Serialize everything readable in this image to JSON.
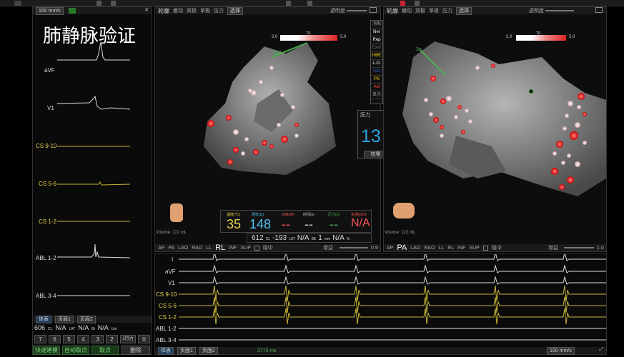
{
  "left_panel": {
    "speed": "150 mm/s",
    "title": "肺静脉验证",
    "channels": [
      {
        "label": "aVF",
        "color": "#dddddd"
      },
      {
        "label": "V1",
        "color": "#dddddd"
      },
      {
        "label": "CS 9-10",
        "color": "#e8d44d"
      },
      {
        "label": "CS 5-6",
        "color": "#e8d44d"
      },
      {
        "label": "CS 1-2",
        "color": "#e8d44d"
      },
      {
        "label": "ABL 1-2",
        "color": "#dddddd"
      },
      {
        "label": "ABL 3-4",
        "color": "#dddddd"
      }
    ],
    "tabs": [
      "体表",
      "页面1",
      "页面2"
    ],
    "readout": {
      "cl_val": "606",
      "cl_unit": "CL",
      "lat_val": "N/A",
      "lat_unit": "LAT",
      "bi_val": "N/A",
      "bi_unit": "Bi",
      "uni_val": "N/A",
      "uni_unit": "Uni"
    },
    "keys": [
      "7",
      "6",
      "5",
      "4",
      "3",
      "2",
      "1行力",
      "0"
    ],
    "buttons": [
      "快速建模",
      "自动取点",
      "取点",
      "删除"
    ]
  },
  "map_left": {
    "title": "轮廓",
    "menu": [
      "撤动",
      "双极",
      "单极",
      "压力"
    ],
    "dropdown": "选择",
    "opacity_label": "透明度",
    "scale_min": "2.0",
    "scale_mid": "TR",
    "scale_max": "5.0",
    "view": "RL",
    "views": [
      "AP",
      "PA",
      "LAO",
      "RAO",
      "LL",
      "RL",
      "INF",
      "SUP"
    ],
    "check_label": "隐中",
    "slider_label": "增益",
    "slider_value": "0.9",
    "volume": "Volume: 122 mL",
    "annotation": "13m"
  },
  "map_right": {
    "title": "轮廓",
    "menu": [
      "撤动",
      "双极",
      "单极",
      "压力"
    ],
    "dropdown": "选择",
    "opacity_label": "透明度",
    "scale_min": "2.0",
    "scale_mid": "TR",
    "scale_max": "5.0",
    "view": "PA",
    "views": [
      "AP",
      "PA",
      "LAO",
      "RAO",
      "LL",
      "RL",
      "INF",
      "SUP"
    ],
    "check_label": "隐中",
    "slider_label": "增益",
    "slider_value": "1.0",
    "volume": "Volume: 122 mL",
    "annotation": "3n"
  },
  "legend": {
    "items": [
      {
        "label": "消融",
        "color": "#999999"
      },
      {
        "label": "Ner",
        "color": "#ffffff"
      },
      {
        "label": "Rep",
        "color": "#ffffff"
      },
      {
        "label": "Exer",
        "color": "#666666"
      },
      {
        "label": "HBE",
        "color": "#ffd700"
      },
      {
        "label": "L.O.",
        "color": "#ffffff"
      },
      {
        "label": "ISA",
        "color": "#3b5bdb"
      },
      {
        "label": "PS",
        "color": "#ffd700"
      },
      {
        "label": "Abl",
        "color": "#ff4444"
      },
      {
        "label": "显示",
        "color": "#999999"
      }
    ]
  },
  "pressure": {
    "title": "压力",
    "value": "13",
    "unit": "g",
    "button": "校零"
  },
  "metrics": {
    "headers": [
      {
        "label": "温度(°C)",
        "color": "#e8d44d"
      },
      {
        "label": "阻抗(Ω)",
        "color": "#4fc3f7"
      },
      {
        "label": "功率(W)",
        "color": "#ff5555"
      },
      {
        "label": "时间(s)",
        "color": "#cccccc"
      },
      {
        "label": "压力(g)",
        "color": "#4caf50"
      },
      {
        "label": "实测(Ω%)",
        "color": "#ff5555"
      }
    ],
    "values": [
      {
        "text": "35",
        "color": "#e8d44d"
      },
      {
        "text": "148",
        "color": "#4fc3f7"
      },
      {
        "text": "--",
        "color": "#ff5555"
      },
      {
        "text": "--",
        "color": "#cccccc"
      },
      {
        "text": "--",
        "color": "#4caf50"
      },
      {
        "text": "N/A",
        "color": "#ff5555"
      }
    ],
    "row2": [
      {
        "val": "612",
        "unit": "CL"
      },
      {
        "val": "-193",
        "unit": "LAT"
      },
      {
        "val": "N/A",
        "unit": "BE"
      },
      {
        "val": "1",
        "unit": "mm"
      },
      {
        "val": "N/A",
        "unit": "%"
      }
    ]
  },
  "bottom_panel": {
    "channels": [
      {
        "label": "I",
        "color": "#dddddd"
      },
      {
        "label": "aVF",
        "color": "#dddddd"
      },
      {
        "label": "V1",
        "color": "#dddddd"
      },
      {
        "label": "CS 9-10",
        "color": "#e8d44d"
      },
      {
        "label": "CS 5-6",
        "color": "#e8d44d"
      },
      {
        "label": "CS 1-2",
        "color": "#e8d44d"
      },
      {
        "label": "ABL 1-2",
        "color": "#dddddd"
      },
      {
        "label": "ABL 3-4",
        "color": "#dddddd"
      }
    ],
    "tabs": [
      "体表",
      "页面1",
      "页面2"
    ],
    "timestamp": "3773 ms",
    "speed": "100 mm/s"
  }
}
